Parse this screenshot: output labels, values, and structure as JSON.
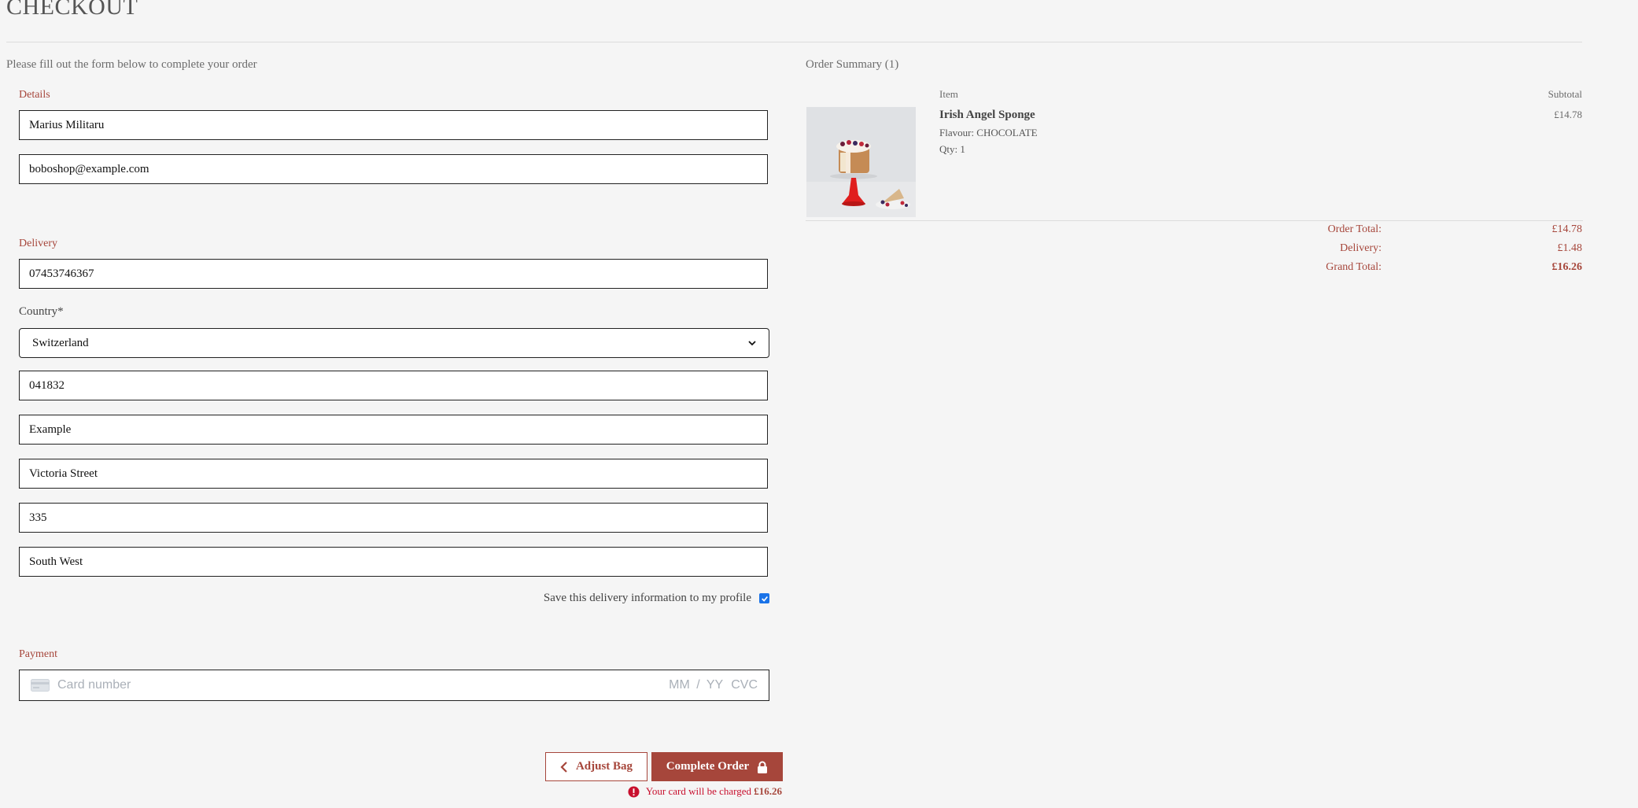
{
  "header": {
    "title": "CHECKOUT"
  },
  "form": {
    "intro": "Please fill out the form below to complete your order",
    "details": {
      "label": "Details",
      "full_name": "Marius Militaru",
      "email": "boboshop@example.com"
    },
    "delivery": {
      "label": "Delivery",
      "phone": "07453746367",
      "country_label": "Country*",
      "country": "Switzerland",
      "postcode": "041832",
      "town": "Example",
      "street1": "Victoria Street",
      "street2": "335",
      "county": "South West",
      "save_label": "Save this delivery information to my profile",
      "save_checked": true
    },
    "payment": {
      "label": "Payment",
      "card_placeholder": "Card number",
      "expiry_placeholder": "MM / YY",
      "cvc_placeholder": "CVC"
    },
    "buttons": {
      "adjust_label": "Adjust Bag",
      "complete_label": "Complete Order"
    },
    "charge_note": "Your card will be charged",
    "charge_amount": "£16.26"
  },
  "summary": {
    "title": "Order Summary (1)",
    "col_item": "Item",
    "col_subtotal": "Subtotal",
    "items": [
      {
        "name": "Irish Angel Sponge",
        "flavour": "Flavour: CHOCOLATE",
        "qty": "Qty: 1",
        "subtotal": "£14.78"
      }
    ],
    "order_total_label": "Order Total:",
    "order_total": "£14.78",
    "delivery_label": "Delivery:",
    "delivery": "£1.48",
    "grand_total_label": "Grand Total:",
    "grand_total": "£16.26"
  },
  "colors": {
    "accent": "#a6463b",
    "error": "#c8102e",
    "checkbox": "#1a73e8"
  }
}
